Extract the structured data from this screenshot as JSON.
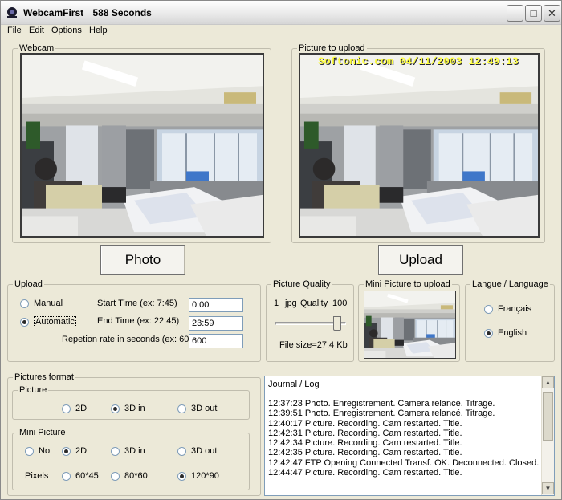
{
  "window": {
    "title": "WebcamFirst",
    "elapsed": "588 Seconds",
    "controls": {
      "minimize": "–",
      "maximize": "□",
      "close": "✕"
    }
  },
  "menu": [
    "File",
    "Edit",
    "Options",
    "Help"
  ],
  "webcam": {
    "label": "Webcam"
  },
  "upload_preview": {
    "label": "Picture to upload",
    "overlay": "Softonic.com 04/11/2003 12:49:13"
  },
  "buttons": {
    "photo": "Photo",
    "upload": "Upload"
  },
  "upload": {
    "label": "Upload",
    "manual": "Manual",
    "automatic": "Automatic",
    "start_label": "Start Time (ex: 7:45)",
    "start_value": "0:00",
    "end_label": "End Time (ex: 22:45)",
    "end_value": "23:59",
    "rate_label": "Repetion rate in seconds (ex: 600)",
    "rate_value": "600"
  },
  "quality": {
    "label": "Picture Quality",
    "min": "1",
    "format": "jpg",
    "quality_word": "Quality",
    "max": "100",
    "value": 92,
    "file_size": "File size=27,4 Kb"
  },
  "mini_picture": {
    "label": "Mini Picture to upload"
  },
  "language": {
    "label": "Langue / Language",
    "french": "Français",
    "english": "English",
    "selected": "English"
  },
  "pictures_format": {
    "label": "Pictures format",
    "picture": {
      "label": "Picture",
      "options": [
        "2D",
        "3D in",
        "3D out"
      ],
      "selected": "3D in"
    },
    "mini": {
      "label": "Mini Picture",
      "options": [
        "No",
        "2D",
        "3D in",
        "3D out"
      ],
      "selected": "2D",
      "pixels_label": "Pixels",
      "pixel_options": [
        "60*45",
        "80*60",
        "120*90"
      ],
      "pixel_selected": "120*90"
    }
  },
  "log": {
    "title": "Journal / Log",
    "lines": [
      "12:37:23 Photo. Enregistrement. Camera relancé. Titrage.",
      "12:39:51 Photo. Enregistrement. Camera relancé. Titrage.",
      "12:40:17 Picture. Recording. Cam restarted. Title.",
      "12:42:31 Picture. Recording. Cam restarted. Title.",
      "12:42:34 Picture. Recording. Cam restarted. Title.",
      "12:42:35 Picture. Recording. Cam restarted. Title.",
      "12:42:47 FTP Opening Connected Transf. OK. Deconnected. Closed.",
      "12:44:47 Picture. Recording. Cam restarted. Title."
    ]
  },
  "colors": {
    "window_bg": "#ece9d8",
    "overlay_text": "#ffff40"
  }
}
